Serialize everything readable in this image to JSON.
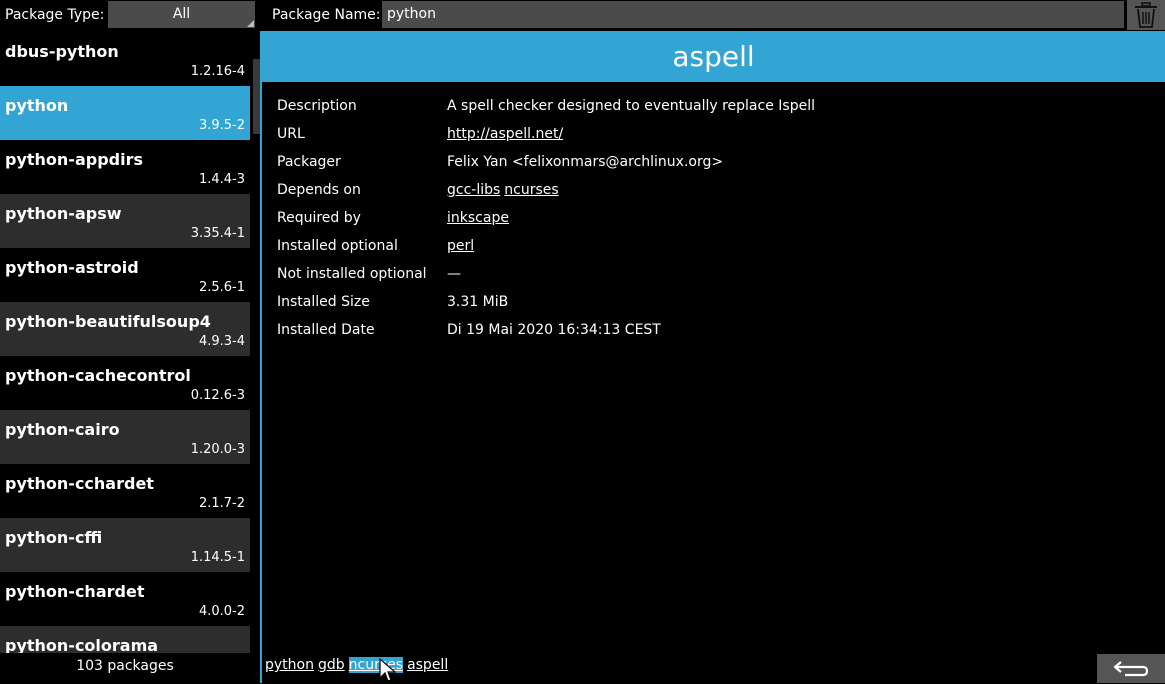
{
  "toolbar": {
    "package_type_label": "Package Type:",
    "package_type_value": "All",
    "package_name_label": "Package Name:",
    "package_name_value": "python",
    "trash_icon": "trash-icon"
  },
  "sidebar": {
    "packages": [
      {
        "name": "dbus-python",
        "version": "1.2.16-4"
      },
      {
        "name": "python",
        "version": "3.9.5-2"
      },
      {
        "name": "python-appdirs",
        "version": "1.4.4-3"
      },
      {
        "name": "python-apsw",
        "version": "3.35.4-1"
      },
      {
        "name": "python-astroid",
        "version": "2.5.6-1"
      },
      {
        "name": "python-beautifulsoup4",
        "version": "4.9.3-4"
      },
      {
        "name": "python-cachecontrol",
        "version": "0.12.6-3"
      },
      {
        "name": "python-cairo",
        "version": "1.20.0-3"
      },
      {
        "name": "python-cchardet",
        "version": "2.1.7-2"
      },
      {
        "name": "python-cffi",
        "version": "1.14.5-1"
      },
      {
        "name": "python-chardet",
        "version": "4.0.0-2"
      },
      {
        "name": "python-colorama",
        "version": ""
      }
    ],
    "selected_index": 1,
    "count_text": "103 packages"
  },
  "detail": {
    "title": "aspell",
    "rows": {
      "description": {
        "label": "Description",
        "value": "A spell checker designed to eventually replace Ispell"
      },
      "url": {
        "label": "URL",
        "value": "http://aspell.net/"
      },
      "packager": {
        "label": "Packager",
        "value": "Felix Yan <felixonmars@archlinux.org>"
      },
      "depends_on": {
        "label": "Depends on",
        "links": [
          "gcc-libs",
          "ncurses"
        ]
      },
      "required_by": {
        "label": "Required by",
        "links": [
          "inkscape"
        ]
      },
      "installed_optional": {
        "label": "Installed optional",
        "links": [
          "perl"
        ]
      },
      "not_installed_optional": {
        "label": "Not installed optional",
        "value": "—"
      },
      "installed_size": {
        "label": "Installed Size",
        "value": "3.31 MiB"
      },
      "installed_date": {
        "label": "Installed Date",
        "value": "Di 19 Mai 2020 16:34:13 CEST"
      }
    }
  },
  "breadcrumb": {
    "items": [
      "python",
      "gdb",
      "ncurses",
      "aspell"
    ],
    "active_index": 2
  },
  "footer": {
    "back_icon": "back-arrow-icon"
  },
  "colors": {
    "accent": "#33a5d4",
    "control_bg": "#4b4b4b",
    "row_alt_bg": "#2d2d2d",
    "background": "#000000"
  }
}
